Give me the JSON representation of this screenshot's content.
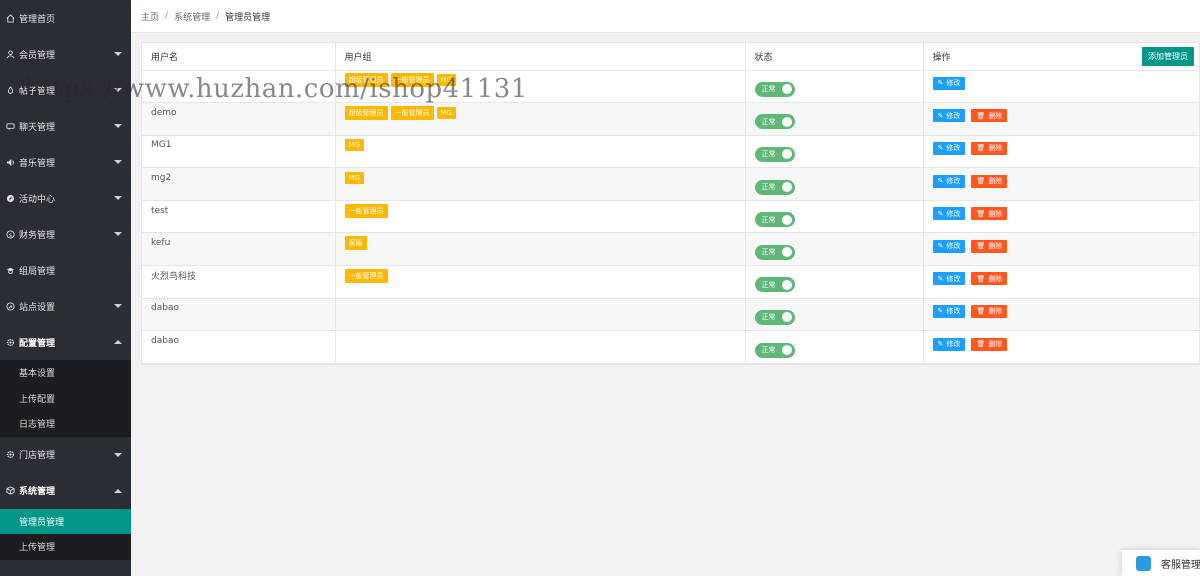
{
  "sidebar": {
    "items": [
      {
        "label": "管理首页",
        "icon": "home-icon",
        "arrow": ""
      },
      {
        "label": "会员管理",
        "icon": "user-icon",
        "arrow": "down"
      },
      {
        "label": "帖子管理",
        "icon": "fire-icon",
        "arrow": "down"
      },
      {
        "label": "聊天管理",
        "icon": "chat-icon",
        "arrow": "down"
      },
      {
        "label": "音乐管理",
        "icon": "music-icon",
        "arrow": "down"
      },
      {
        "label": "活动中心",
        "icon": "compass-icon",
        "arrow": "down"
      },
      {
        "label": "财务管理",
        "icon": "money-icon",
        "arrow": "down"
      },
      {
        "label": "组局管理",
        "icon": "group-icon",
        "arrow": ""
      },
      {
        "label": "站点设置",
        "icon": "site-icon",
        "arrow": "down"
      },
      {
        "label": "配置管理",
        "icon": "gear-icon",
        "arrow": "up"
      }
    ],
    "config_sub": [
      "基本设置",
      "上传配置",
      "日志管理"
    ],
    "store_item": {
      "label": "门店管理",
      "icon": "store-icon",
      "arrow": "down"
    },
    "system_item": {
      "label": "系统管理",
      "icon": "cube-icon",
      "arrow": "up"
    },
    "system_sub": [
      "管理员管理",
      "上传管理"
    ]
  },
  "breadcrumb": {
    "home": "主页",
    "section": "系统管理",
    "current": "管理员管理"
  },
  "table": {
    "headers": {
      "name": "用户名",
      "group": "用户组",
      "status": "状态",
      "action": "操作"
    },
    "add_button": "添加管理员",
    "edit_label": "修改",
    "delete_label": "删除",
    "rows": [
      {
        "name": "",
        "groups": [
          "超级管理员",
          "一般管理员",
          "MG"
        ],
        "status": "正常",
        "deletable": false
      },
      {
        "name": "demo",
        "groups": [
          "超级管理员",
          "一般管理员",
          "MG"
        ],
        "status": "正常",
        "deletable": true
      },
      {
        "name": "MG1",
        "groups": [
          "MG"
        ],
        "status": "正常",
        "deletable": true
      },
      {
        "name": "mg2",
        "groups": [
          "MG"
        ],
        "status": "正常",
        "deletable": true
      },
      {
        "name": "test",
        "groups": [
          "一般管理员"
        ],
        "status": "正常",
        "deletable": true
      },
      {
        "name": "kefu",
        "groups": [
          "客服"
        ],
        "status": "正常",
        "deletable": true
      },
      {
        "name": "火烈鸟科技",
        "groups": [
          "一般管理员"
        ],
        "status": "正常",
        "deletable": true
      },
      {
        "name": "dabao",
        "groups": [],
        "status": "正常",
        "deletable": true
      },
      {
        "name": "dabao",
        "groups": [],
        "status": "正常",
        "deletable": true
      }
    ]
  },
  "watermark": "https://www.huzhan.com/ishop41131",
  "cs_widget": {
    "label": "客服管理"
  },
  "colors": {
    "sidebar": "#2a2d33",
    "active": "#009688",
    "tag": "#ffb800",
    "switch": "#5fb878",
    "edit": "#1e9fff",
    "delete": "#ff5722"
  }
}
